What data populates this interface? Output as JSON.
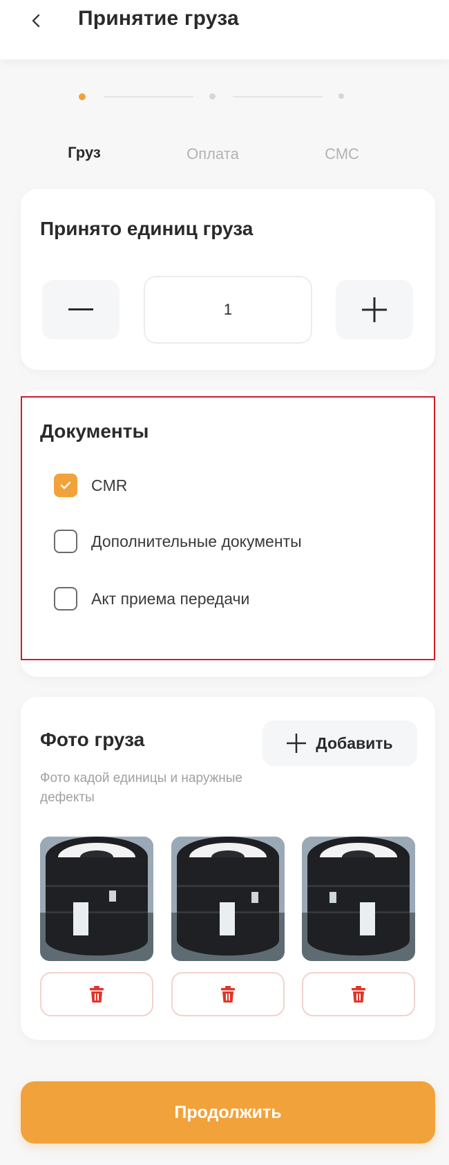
{
  "header": {
    "title": "Принятие груза",
    "back_icon": "chevron-left-icon"
  },
  "stepper": {
    "steps": [
      {
        "label": "Груз",
        "active": true
      },
      {
        "label": "Оплата",
        "active": false
      },
      {
        "label": "СМС",
        "active": false
      }
    ],
    "active_color": "#f0a23a"
  },
  "units": {
    "title": "Принято единиц груза",
    "value": "1",
    "minus_icon": "minus-icon",
    "plus_icon": "plus-icon"
  },
  "documents": {
    "title": "Документы",
    "items": [
      {
        "label": "CMR",
        "checked": true
      },
      {
        "label": "Дополнительные документы",
        "checked": false
      },
      {
        "label": "Акт приема передачи",
        "checked": false
      }
    ],
    "highlight_color": "#cc1e2a"
  },
  "photos": {
    "title": "Фото груза",
    "add_label": "Добавить",
    "add_icon": "plus-icon",
    "subtitle": "Фото кадой единицы и наружные дефекты",
    "delete_icon": "trash-icon",
    "delete_color": "#e0352b",
    "items": [
      {
        "image": "cargo-photo"
      },
      {
        "image": "cargo-photo"
      },
      {
        "image": "cargo-photo"
      }
    ]
  },
  "footer": {
    "continue_label": "Продолжить",
    "accent_color": "#f2a23a"
  }
}
